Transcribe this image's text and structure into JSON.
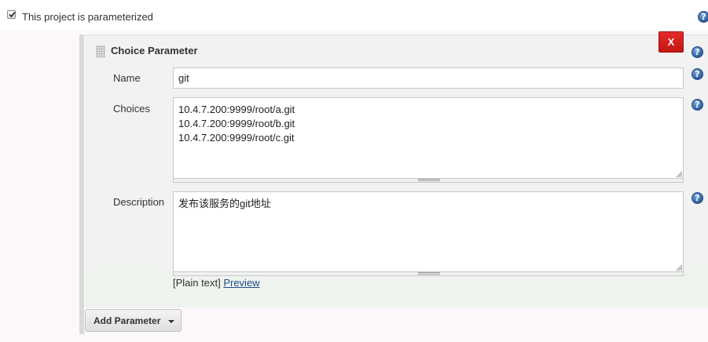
{
  "parameterized": {
    "label": "This project is parameterized",
    "checked": true
  },
  "parameter": {
    "title": "Choice Parameter",
    "delete_label": "X",
    "name": {
      "label": "Name",
      "value": "git"
    },
    "choices": {
      "label": "Choices",
      "value": "10.4.7.200:9999/root/a.git\n10.4.7.200:9999/root/b.git\n10.4.7.200:9999/root/c.git"
    },
    "description": {
      "label": "Description",
      "value": "发布该服务的git地址",
      "format_prefix": "[Plain text]",
      "preview_label": "Preview"
    }
  },
  "add_parameter_label": "Add Parameter",
  "icons": {
    "help": "help-icon",
    "checkbox": "checkmark-icon",
    "grip": "drag-handle-icon",
    "caret": "caret-down-icon"
  },
  "colors": {
    "delete_button": "#d42020",
    "link": "#204a87",
    "help_icon": "#2c5c9e"
  }
}
